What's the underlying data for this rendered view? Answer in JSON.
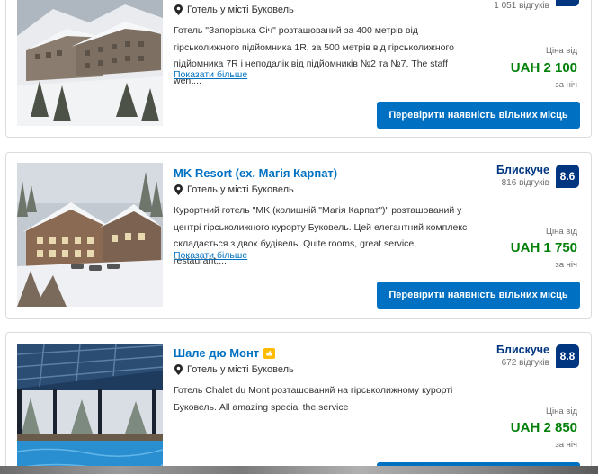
{
  "hotels": [
    {
      "name": "",
      "location": "Готель у місті Буковель",
      "description": "Готель \"Запорізька Січ\" розташований за 400 метрів від гірськолижного підйомника 1R, за 500 метрів від гірськолижного підйомника 7R і неподалік від підйомників №2 та №7. The staff went...",
      "more": "Показати більше",
      "review_word": "",
      "review_count": "1 051 відгуків",
      "score": "",
      "price_label": "Ціна від",
      "price": "UAH 2 100",
      "per_night": "за ніч",
      "cta": "Перевірити наявність вільних місць"
    },
    {
      "name": "MK Resort (ex. Магія Карпат)",
      "location": "Готель у місті Буковель",
      "description": "Курортний готель \"MK (колишній \"Магія Карпат\")\" розташований у центрі гірськолижного курорту Буковель. Цей елегантний комплекс складається з двох будівель. Quite rooms, great service, restaurant,...",
      "more": "Показати більше",
      "review_word": "Блискуче",
      "review_count": "816 відгуків",
      "score": "8.6",
      "price_label": "Ціна від",
      "price": "UAH 1 750",
      "per_night": "за ніч",
      "cta": "Перевірити наявність вільних місць"
    },
    {
      "name": "Шале дю Монт",
      "location": "Готель у місті Буковель",
      "description": "Готель Chalet du Mont розташований на гірськолижному курорті Буковель. All amazing special the service",
      "more": "",
      "review_word": "Блискуче",
      "review_count": "672 відгуків",
      "score": "8.8",
      "price_label": "Ціна від",
      "price": "UAH 2 850",
      "per_night": "за ніч",
      "cta": ""
    }
  ],
  "colors": {
    "link_blue": "#0071c2",
    "score_navy": "#003580",
    "price_green": "#008009",
    "badge_yellow": "#febb02"
  },
  "icons": [
    "pin-icon",
    "thumbs-up-badge-icon"
  ]
}
